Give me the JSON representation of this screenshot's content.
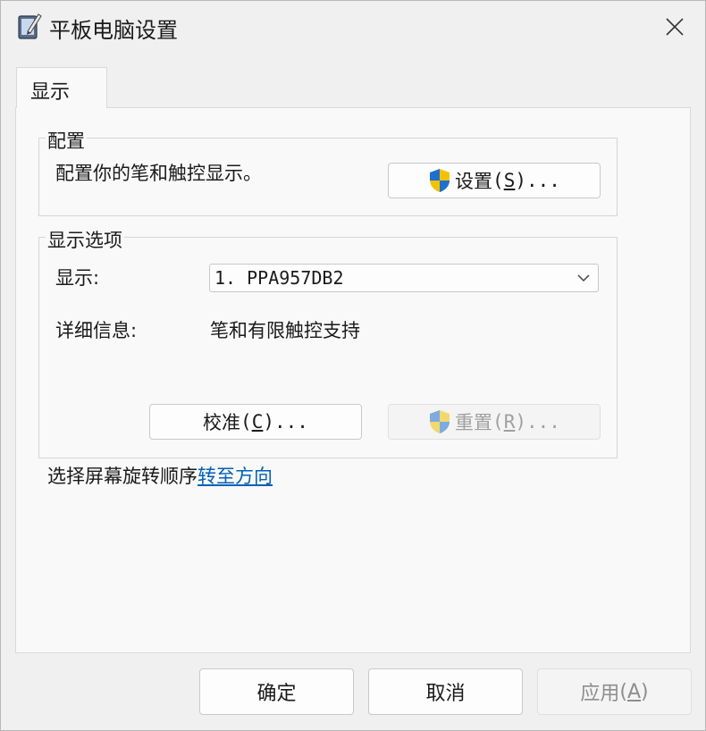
{
  "window": {
    "title": "平板电脑设置",
    "app_icon": "tablet-pen-icon",
    "close_icon": "close-icon"
  },
  "tabs": [
    {
      "label": "显示",
      "selected": true
    }
  ],
  "config_group": {
    "title": "配置",
    "description": "配置你的笔和触控显示。",
    "setup_button": {
      "label": "设置",
      "mnemonic": "S",
      "suffix": "...",
      "icon": "uac-shield-icon"
    }
  },
  "display_options": {
    "title": "显示选项",
    "display_label": "显示:",
    "display_value": "1.  PPA957DB2",
    "details_label": "详细信息:",
    "details_value": "笔和有限触控支持",
    "calibrate_button": {
      "label": "校准",
      "mnemonic": "C",
      "suffix": "..."
    },
    "reset_button": {
      "label": "重置",
      "mnemonic": "R",
      "suffix": "...",
      "icon": "uac-shield-icon",
      "disabled": true
    }
  },
  "rotation": {
    "text": "选择屏幕旋转顺序",
    "link": "转至方向"
  },
  "footer": {
    "ok_label": "确定",
    "cancel_label": "取消",
    "apply_label": "应用",
    "apply_mnemonic": "A",
    "apply_disabled": true
  },
  "colors": {
    "link": "#0060b6",
    "shield_blue": "#1e6fd0",
    "shield_yellow": "#f2c200"
  }
}
